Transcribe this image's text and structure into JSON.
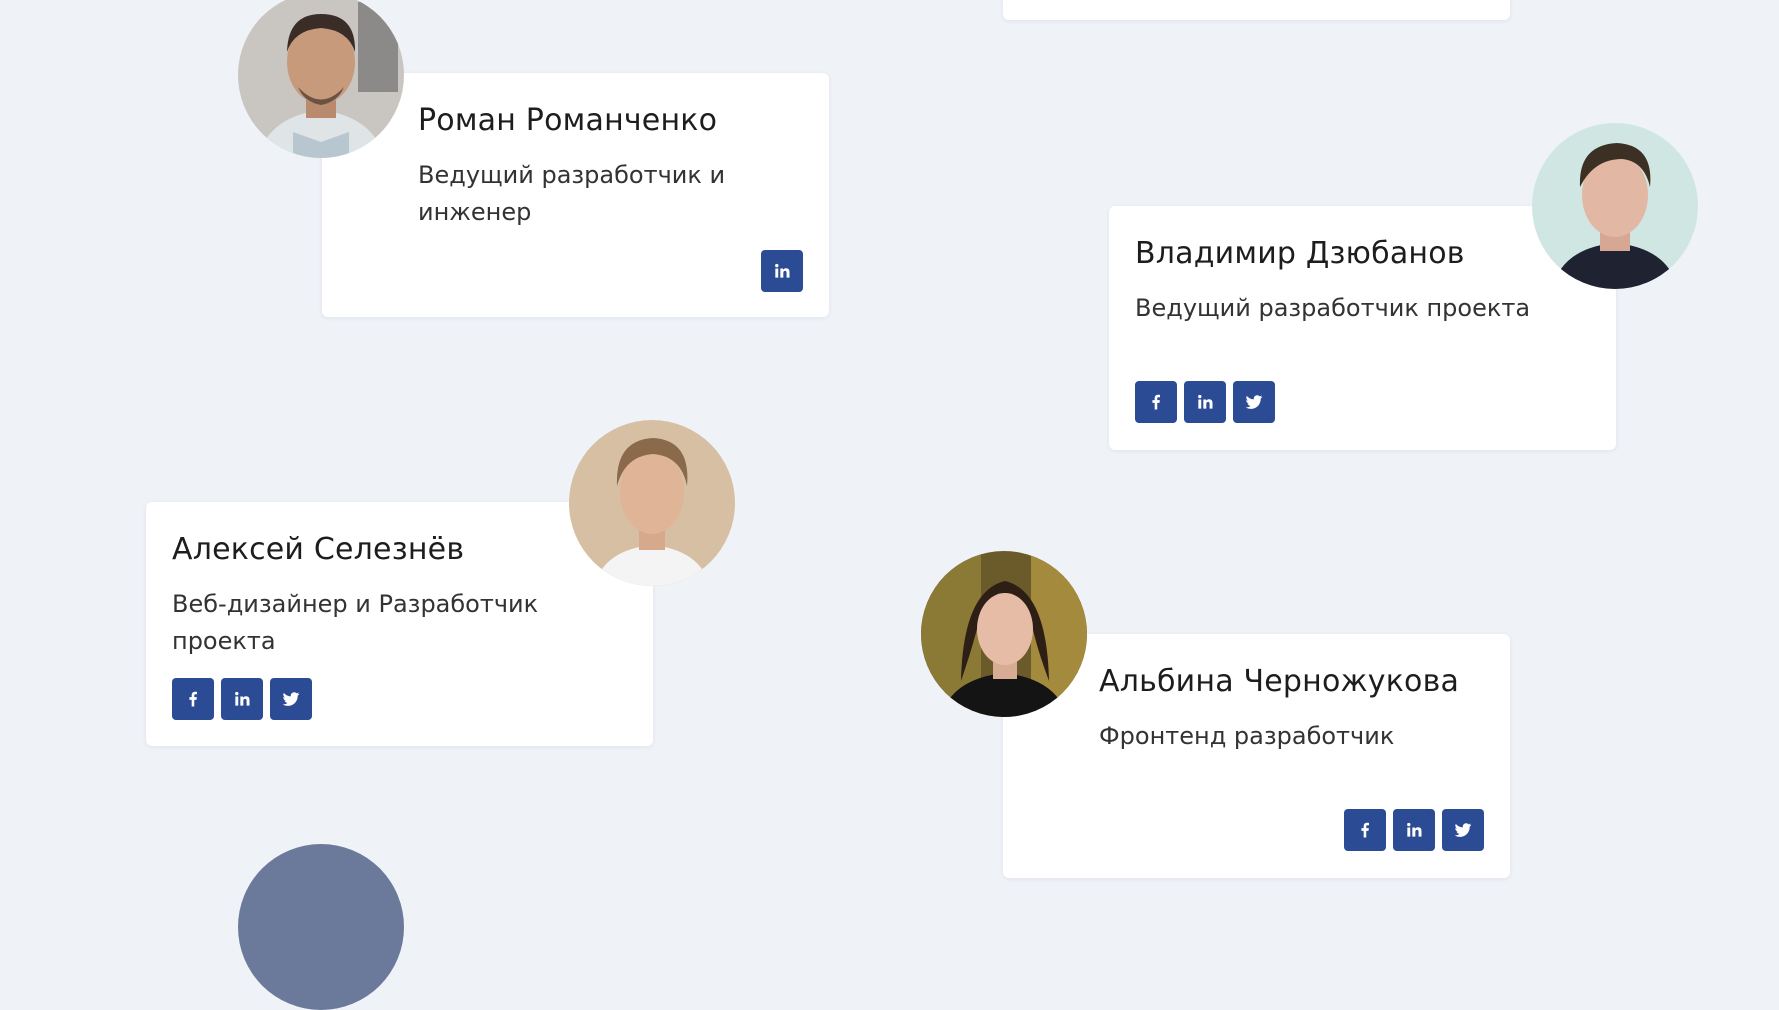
{
  "team": [
    {
      "name": "Роман Романченко",
      "role": "Ведущий разработчик и инженер",
      "socials": [
        "linkedin-icon"
      ]
    },
    {
      "name": "Владимир Дзюбанов",
      "role": "Ведущий разработчик проекта",
      "socials": [
        "facebook-icon",
        "linkedin-icon",
        "twitter-icon"
      ]
    },
    {
      "name": "Алексей Селезнёв",
      "role": "Веб-дизайнер и Разработчик проекта",
      "socials": [
        "facebook-icon",
        "linkedin-icon",
        "twitter-icon"
      ]
    },
    {
      "name": "Альбина Черножукова",
      "role": "Фронтенд разработчик",
      "socials": [
        "facebook-icon",
        "linkedin-icon",
        "twitter-icon"
      ]
    }
  ],
  "colors": {
    "background": "#eff2f7",
    "social_button": "#2b4b94",
    "card": "#ffffff"
  }
}
